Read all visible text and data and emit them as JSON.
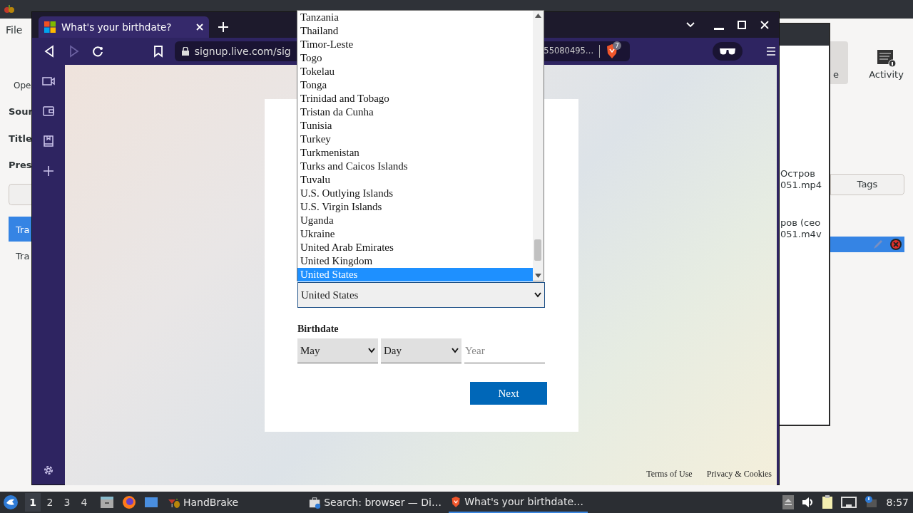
{
  "handbrake": {
    "menu": [
      "File"
    ],
    "left_labels": [
      {
        "text": "Ope",
        "kind": "plain"
      },
      {
        "text": "Sour",
        "kind": "bold"
      },
      {
        "text": "Title",
        "kind": "bold"
      },
      {
        "text": "Pres",
        "kind": "bold"
      }
    ],
    "tabs": [
      {
        "label": "Tra",
        "selected": true
      },
      {
        "label": "Tra",
        "selected": false
      }
    ],
    "toolbar": [
      {
        "label": "e",
        "selected": true
      },
      {
        "label": "Activity",
        "selected": false
      }
    ],
    "tags_button": "Tags",
    "queue_items": [
      {
        "lines": [
          "Остров",
          "051.mp4"
        ],
        "selected": false
      },
      {
        "lines": [
          "ров (сео",
          "051.m4v"
        ],
        "selected": true
      }
    ]
  },
  "browser": {
    "tab_title": "What's your birthdate?",
    "url_start": "signup.live.com/sig",
    "url_end": "55080495…",
    "shields_count": "7",
    "page": {
      "country_options": [
        {
          "label": "Tanzania",
          "selected": false
        },
        {
          "label": "Thailand",
          "selected": false
        },
        {
          "label": "Timor-Leste",
          "selected": false
        },
        {
          "label": "Togo",
          "selected": false
        },
        {
          "label": "Tokelau",
          "selected": false
        },
        {
          "label": "Tonga",
          "selected": false
        },
        {
          "label": "Trinidad and Tobago",
          "selected": false
        },
        {
          "label": "Tristan da Cunha",
          "selected": false
        },
        {
          "label": "Tunisia",
          "selected": false
        },
        {
          "label": "Turkey",
          "selected": false
        },
        {
          "label": "Turkmenistan",
          "selected": false
        },
        {
          "label": "Turks and Caicos Islands",
          "selected": false
        },
        {
          "label": "Tuvalu",
          "selected": false
        },
        {
          "label": "U.S. Outlying Islands",
          "selected": false
        },
        {
          "label": "U.S. Virgin Islands",
          "selected": false
        },
        {
          "label": "Uganda",
          "selected": false
        },
        {
          "label": "Ukraine",
          "selected": false
        },
        {
          "label": "United Arab Emirates",
          "selected": false
        },
        {
          "label": "United Kingdom",
          "selected": false
        },
        {
          "label": "United States",
          "selected": true
        }
      ],
      "country_value": "United States",
      "birthdate_label": "Birthdate",
      "month_value": "May",
      "day_value": "Day",
      "year_placeholder": "Year",
      "next_button": "Next",
      "footer_links": [
        "Terms of Use",
        "Privacy & Cookies"
      ]
    }
  },
  "taskbar": {
    "workspaces": [
      {
        "label": "1",
        "selected": true
      },
      {
        "label": "2",
        "selected": false
      },
      {
        "label": "3",
        "selected": false
      },
      {
        "label": "4",
        "selected": false
      }
    ],
    "tasks": [
      {
        "label": "HandBrake",
        "kind": "handbrake",
        "selected": false
      },
      {
        "label": "Search: browser — Di…",
        "kind": "search",
        "selected": false
      },
      {
        "label": "What's your birthdate…",
        "kind": "brave",
        "selected": true
      }
    ],
    "clock": "8:57"
  }
}
